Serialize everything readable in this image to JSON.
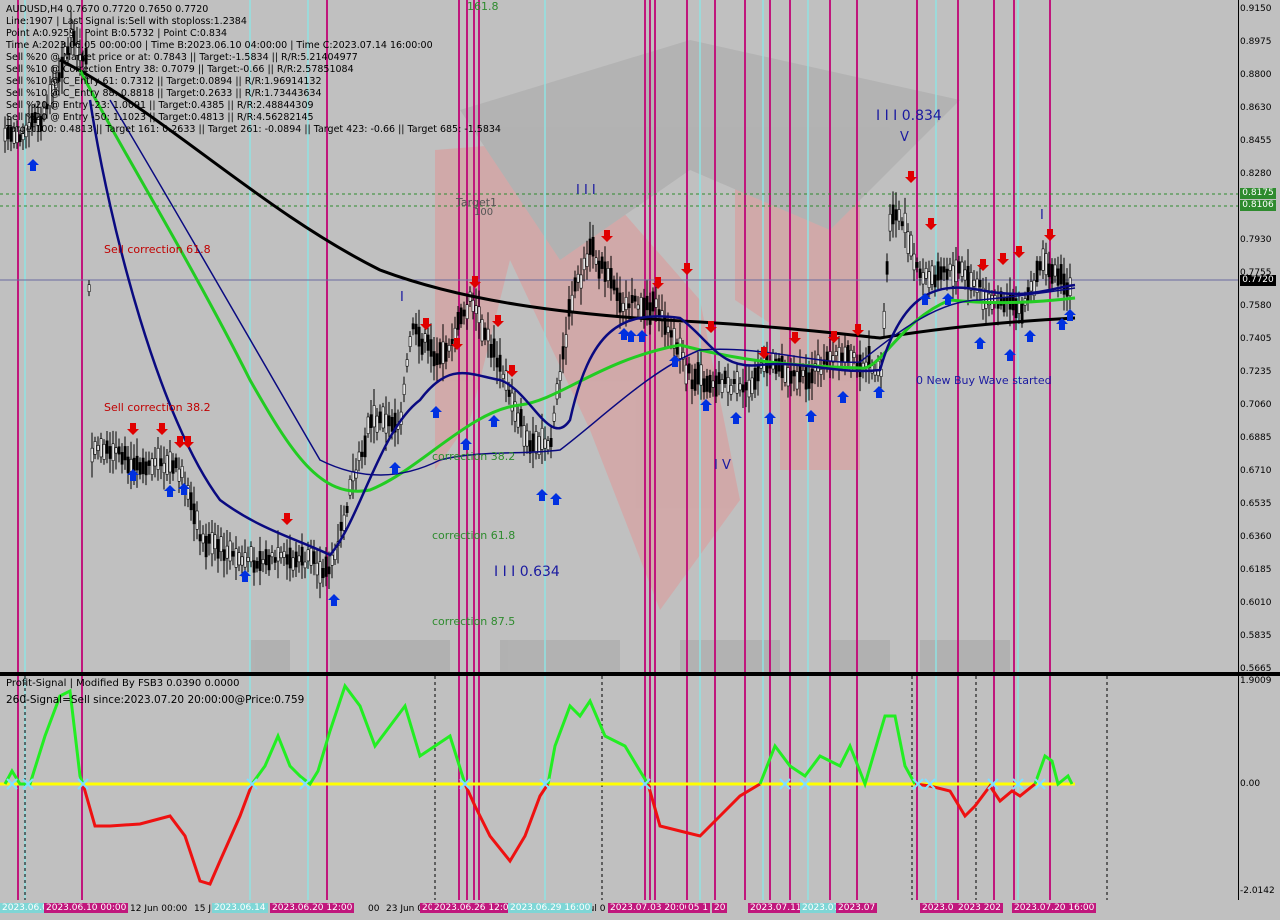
{
  "header": {
    "symbol_line": "AUDUSD,H4  0.7670 0.7720 0.7650 0.7720",
    "lines": [
      "Line:1907 | Last Signal is:Sell with stoploss:1.2384",
      "Point A:0.9259 | Point B:0.5732 | Point C:0.834",
      "Time A:2023.06.05 00:00:00 | Time B:2023.06.10 04:00:00 | Time C:2023.07.14 16:00:00",
      "Sell %20 @ Market price or at: 0.7843 || Target:-1.5834 || R/R:5.21404977",
      "Sell %10 @ Correction Entry 38: 0.7079 || Target:-0.66 || R/R:2.57851084",
      "Sell %10 @ C_Entry 61: 0.7312 || Target:0.0894 || R/R:1.96914132",
      "Sell %10 @ C_Entry 88: 0.8818 || Target:0.2633 || R/R:1.73443634",
      "Sell %20 @ Entry -23: 1.0091 || Target:0.4385 || R/R:2.48844309",
      "Sell %20 @ Entry -50: 1.1023 || Target:0.4813 || R/R:4.56282145",
      "Target100: 0.4813 || Target 161: 0.2633 || Target 261: -0.0894 || Target 423: -0.66 || Target 685: -1.5834"
    ]
  },
  "chart_labels": {
    "top_161": "161.8",
    "target1": "Target1",
    "target_100": "100",
    "sell_corr_618": "Sell correction 61.8",
    "sell_corr_382": "Sell correction 38.2",
    "corr_382": "correction 38.2",
    "corr_618": "correction 61.8",
    "corr_875": "correction 87.5",
    "wave_iii_634": "I I I 0.634",
    "wave_iii": "I I I",
    "wave_iv": "I V",
    "wave_iii_834": "I I I 0.834",
    "wave_v": "V",
    "wave_i": "I",
    "wave_i_left": "I",
    "new_buy_wave": "0 New Buy Wave started"
  },
  "price_scale": [
    "0.9150",
    "0.8975",
    "0.8800",
    "0.8630",
    "0.8455",
    "0.8280",
    "0.7930",
    "0.7755",
    "0.7580",
    "0.7405",
    "0.7235",
    "0.7060",
    "0.6885",
    "0.6710",
    "0.6535",
    "0.6360",
    "0.6185",
    "0.6010",
    "0.5835",
    "0.5665"
  ],
  "price_badges": [
    {
      "text": "0.8175",
      "color": "#2e8b2e"
    },
    {
      "text": "0.8106",
      "color": "#2e8b2e"
    },
    {
      "text": "0.7720",
      "color": "#000000"
    }
  ],
  "oscillator": {
    "title": "Profit-Signal | Modified By FSB3 0.0390 0.0000",
    "signal": "260-Signal=Sell since:2023.07.20 20:00:00@Price:0.759",
    "scale": [
      "1.9009",
      "0.00",
      "-2.0142"
    ]
  },
  "time_axis": {
    "plain": [
      {
        "text": "12 Jun 00:00"
      },
      {
        "text": "15 J"
      },
      {
        "text": "00"
      },
      {
        "text": "23 Jun 0"
      },
      {
        "text": "Jul 0"
      }
    ],
    "badges": [
      {
        "text": "2023.06.07",
        "cyan": true
      },
      {
        "text": "2023.06.10 00:00",
        "cyan": false
      },
      {
        "text": "2023.06.14",
        "cyan": true
      },
      {
        "text": "2023.06.20 12:00",
        "cyan": false
      },
      {
        "text": "20",
        "cyan": false
      },
      {
        "text": "2023.06.26 12:00",
        "cyan": false
      },
      {
        "text": "2023.06.29 16:00",
        "cyan": true
      },
      {
        "text": "2023.07.03 20:00",
        "cyan": false
      },
      {
        "text": "05 1",
        "cyan": false
      },
      {
        "text": "20",
        "cyan": false
      },
      {
        "text": "2023.07.11",
        "cyan": false
      },
      {
        "text": "2023.07",
        "cyan": true
      },
      {
        "text": "2023.07",
        "cyan": false
      },
      {
        "text": "2023.0",
        "cyan": false
      },
      {
        "text": "2023 202",
        "cyan": false
      },
      {
        "text": "2023.07.20 16:00",
        "cyan": false
      }
    ]
  },
  "colors": {
    "magenta": "#c0177c",
    "cyan": "#8fe3e3",
    "sell_arrow": "#e00000",
    "buy_arrow": "#0030e0",
    "ma_green": "#22cc22",
    "ma_navy": "#0a0a80",
    "ma_black": "#000000"
  }
}
